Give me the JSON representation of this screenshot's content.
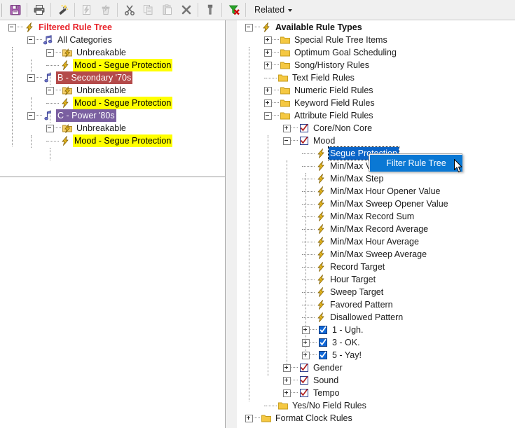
{
  "toolbar": {
    "buttons": [
      {
        "name": "save-button",
        "icon": "floppy-disk-icon",
        "enabled": true
      },
      {
        "name": "print-button",
        "icon": "printer-icon",
        "enabled": true
      },
      {
        "name": "magic-wand-button",
        "icon": "magic-wand-icon",
        "enabled": true
      },
      {
        "name": "new-rule-button",
        "icon": "bolt-page-icon",
        "enabled": false
      },
      {
        "name": "delete-rule-button",
        "icon": "bolt-trash-icon",
        "enabled": false
      },
      {
        "name": "cut-button",
        "icon": "scissors-icon",
        "enabled": true
      },
      {
        "name": "copy-button",
        "icon": "copy-icon",
        "enabled": false
      },
      {
        "name": "paste-button",
        "icon": "paste-icon",
        "enabled": false
      },
      {
        "name": "delete-button",
        "icon": "x-mark-icon",
        "enabled": true
      },
      {
        "name": "tools-button",
        "icon": "wrench-icon",
        "enabled": true
      },
      {
        "name": "clear-filter-button",
        "icon": "filter-clear-icon",
        "enabled": true
      }
    ],
    "related_label": "Related",
    "related_icon": "chevron-down-icon"
  },
  "left_tree": {
    "root": {
      "label": "Filtered Rule Tree",
      "icon": "bolt-icon"
    },
    "nodes": [
      {
        "label": "All Categories",
        "icon": "music-notes-icon"
      },
      {
        "label": "Unbreakable",
        "icon": "bolt-folder-icon"
      },
      {
        "label": "Mood - Segue Protection",
        "icon": "bolt-icon"
      },
      {
        "label": "B - Secondary '70s",
        "icon": "music-note-icon"
      },
      {
        "label": "Unbreakable",
        "icon": "bolt-folder-icon"
      },
      {
        "label": "Mood - Segue Protection",
        "icon": "bolt-icon"
      },
      {
        "label": "C - Power '80s",
        "icon": "music-note-icon"
      },
      {
        "label": "Unbreakable",
        "icon": "bolt-folder-icon"
      },
      {
        "label": "Mood - Segue Protection",
        "icon": "bolt-icon"
      }
    ]
  },
  "right_tree": {
    "root": {
      "label": "Available Rule Types",
      "icon": "bolt-icon"
    },
    "nodes": [
      {
        "label": "Special Rule Tree Items",
        "icon": "folder-icon"
      },
      {
        "label": "Optimum Goal Scheduling",
        "icon": "folder-icon"
      },
      {
        "label": "Song/History Rules",
        "icon": "folder-icon"
      },
      {
        "label": "Text Field Rules",
        "icon": "folder-icon"
      },
      {
        "label": "Numeric Field Rules",
        "icon": "folder-icon"
      },
      {
        "label": "Keyword Field Rules",
        "icon": "folder-icon"
      },
      {
        "label": "Attribute Field Rules",
        "icon": "folder-icon"
      },
      {
        "label": "Core/Non Core",
        "icon": "checkbox-red-icon"
      },
      {
        "label": "Mood",
        "icon": "checkbox-red-icon"
      },
      {
        "label": "Segue Protection",
        "icon": "bolt-icon"
      },
      {
        "label": "Min/Max Value",
        "icon": "bolt-icon"
      },
      {
        "label": "Min/Max Step",
        "icon": "bolt-icon"
      },
      {
        "label": "Min/Max Hour Opener Value",
        "icon": "bolt-icon"
      },
      {
        "label": "Min/Max Sweep Opener Value",
        "icon": "bolt-icon"
      },
      {
        "label": "Min/Max Record Sum",
        "icon": "bolt-icon"
      },
      {
        "label": "Min/Max Record Average",
        "icon": "bolt-icon"
      },
      {
        "label": "Min/Max Hour Average",
        "icon": "bolt-icon"
      },
      {
        "label": "Min/Max Sweep Average",
        "icon": "bolt-icon"
      },
      {
        "label": "Record Target",
        "icon": "bolt-icon"
      },
      {
        "label": "Hour Target",
        "icon": "bolt-icon"
      },
      {
        "label": "Sweep Target",
        "icon": "bolt-icon"
      },
      {
        "label": "Favored Pattern",
        "icon": "bolt-icon"
      },
      {
        "label": "Disallowed Pattern",
        "icon": "bolt-icon"
      },
      {
        "label": "1 - Ugh.",
        "icon": "checkbox-blue-icon"
      },
      {
        "label": "3 - OK.",
        "icon": "checkbox-blue-icon"
      },
      {
        "label": "5 - Yay!",
        "icon": "checkbox-blue-icon"
      },
      {
        "label": "Gender",
        "icon": "checkbox-red-icon"
      },
      {
        "label": "Sound",
        "icon": "checkbox-red-icon"
      },
      {
        "label": "Tempo",
        "icon": "checkbox-red-icon"
      },
      {
        "label": "Yes/No Field Rules",
        "icon": "folder-icon"
      },
      {
        "label": "Format Clock Rules",
        "icon": "folder-icon"
      }
    ]
  },
  "context_menu": {
    "items": [
      {
        "label": "Filter Rule Tree",
        "selected": true
      }
    ]
  },
  "colors": {
    "selection_blue": "#0a64c8",
    "menu_highlight": "#0a78d4",
    "highlight_yellow": "#ffff00",
    "category_b_bg": "#b44a4a",
    "category_c_bg": "#7a5fa0",
    "root_red": "#e8232a",
    "folder_gold": "#f0c040",
    "bolt_gold": "#d4a51e",
    "toolbar_bg": "#f0f0f0"
  }
}
